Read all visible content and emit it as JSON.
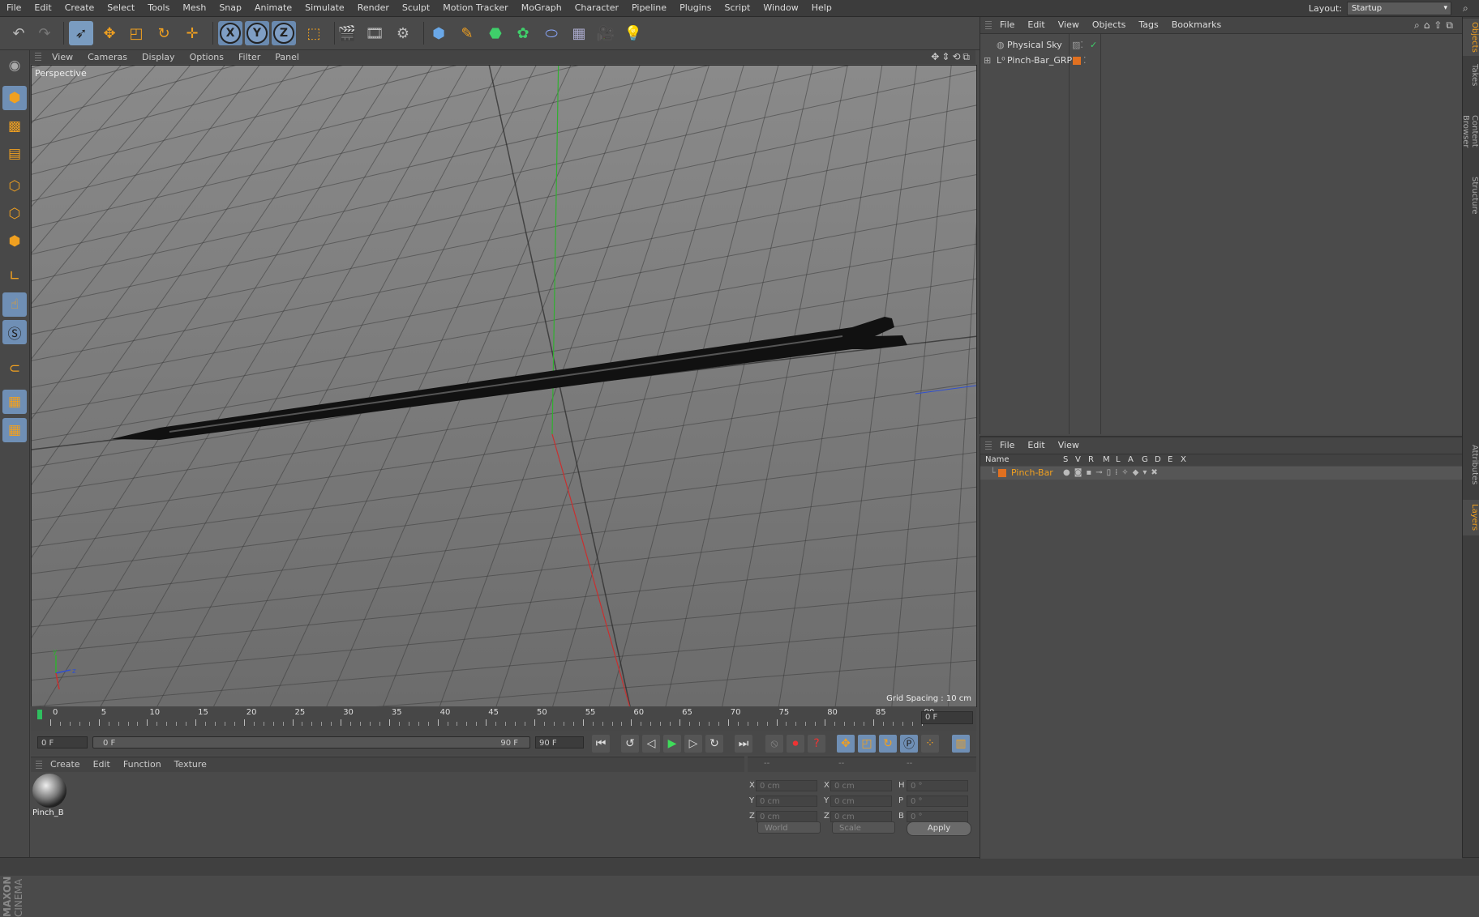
{
  "menubar": {
    "items": [
      "File",
      "Edit",
      "Create",
      "Select",
      "Tools",
      "Mesh",
      "Snap",
      "Animate",
      "Simulate",
      "Render",
      "Sculpt",
      "Motion Tracker",
      "MoGraph",
      "Character",
      "Pipeline",
      "Plugins",
      "Script",
      "Window",
      "Help"
    ],
    "layout_label": "Layout:",
    "layout_value": "Startup"
  },
  "toolbar": {
    "axis_x": "X",
    "axis_y": "Y",
    "axis_z": "Z"
  },
  "viewport": {
    "menu": [
      "View",
      "Cameras",
      "Display",
      "Options",
      "Filter",
      "Panel"
    ],
    "label": "Perspective",
    "grid_spacing": "Grid Spacing : 10 cm",
    "axis_y": "y",
    "axis_z": "z"
  },
  "timeline": {
    "ticks": [
      "0",
      "5",
      "10",
      "15",
      "20",
      "25",
      "30",
      "35",
      "40",
      "45",
      "50",
      "55",
      "60",
      "65",
      "70",
      "75",
      "80",
      "85",
      "90"
    ],
    "frame_end": "0 F"
  },
  "transport": {
    "current": "0 F",
    "range_start": "0 F",
    "range_end": "90 F",
    "max": "90 F"
  },
  "material_manager": {
    "menu": [
      "Create",
      "Edit",
      "Function",
      "Texture"
    ],
    "material_name": "Pinch_B"
  },
  "coordinates": {
    "header": [
      "--",
      "--",
      "--"
    ],
    "rows": [
      {
        "a": "X",
        "a_val": "0 cm",
        "b": "X",
        "b_val": "0 cm",
        "c": "H",
        "c_val": "0 °"
      },
      {
        "a": "Y",
        "a_val": "0 cm",
        "b": "Y",
        "b_val": "0 cm",
        "c": "P",
        "c_val": "0 °"
      },
      {
        "a": "Z",
        "a_val": "0 cm",
        "b": "Z",
        "b_val": "0 cm",
        "c": "B",
        "c_val": "0 °"
      }
    ],
    "space": "World",
    "mode": "Scale",
    "apply": "Apply"
  },
  "object_manager": {
    "menu": [
      "File",
      "Edit",
      "View",
      "Objects",
      "Tags",
      "Bookmarks"
    ],
    "objects": [
      {
        "name": "Physical Sky"
      },
      {
        "name": "Pinch-Bar_GRP"
      }
    ]
  },
  "layer_manager": {
    "menu": [
      "File",
      "Edit",
      "View"
    ],
    "columns": [
      "Name",
      "S",
      "V",
      "R",
      "M",
      "L",
      "A",
      "G",
      "D",
      "E",
      "X"
    ],
    "layers": [
      {
        "name": "Pinch-Bar",
        "color": "#e07020"
      }
    ]
  },
  "right_tabs": [
    "Objects",
    "Takes",
    "Content Browser",
    "Structure",
    "Attributes",
    "Layers"
  ],
  "brand": {
    "line1": "MAXON",
    "line2": "CINEMA 4D"
  },
  "colors": {
    "accent": "#f0a020",
    "playhead": "#2fbf5f",
    "x_axis": "#c83030",
    "y_axis": "#30b030",
    "z_axis": "#3050d0"
  }
}
